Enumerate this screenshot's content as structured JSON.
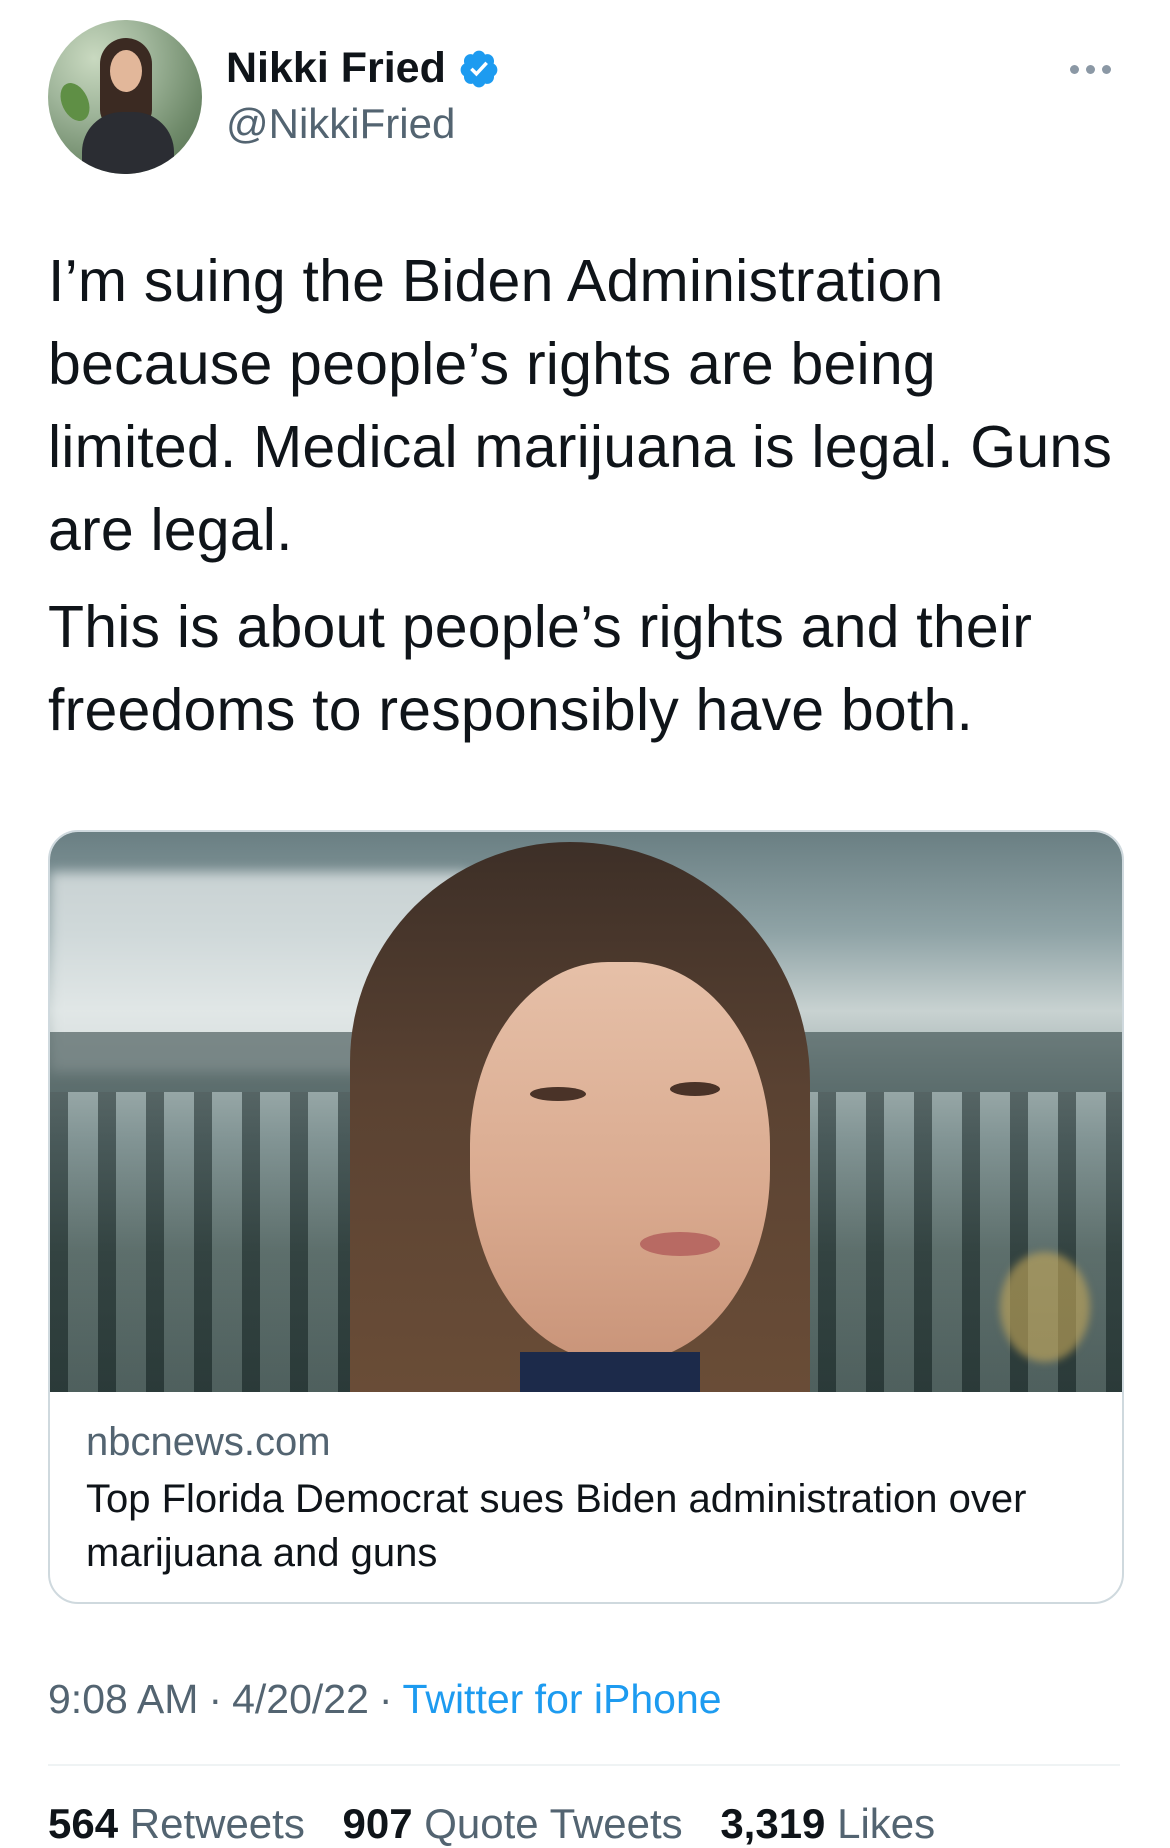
{
  "author": {
    "display_name": "Nikki Fried",
    "handle": "@NikkiFried",
    "verified": true
  },
  "tweet": {
    "paragraphs": [
      "I’m suing the Biden Administration because people’s rights are being limited. Medical marijuana is legal. Guns are legal.",
      "This is about people’s rights and their freedoms to responsibly have both."
    ]
  },
  "link_card": {
    "domain": "nbcnews.com",
    "title": "Top Florida Democrat sues Biden administration over marijuana and guns"
  },
  "meta": {
    "time": "9:08 AM",
    "date": "4/20/22",
    "separator": "·",
    "source": "Twitter for iPhone"
  },
  "stats": {
    "retweets_count": "564",
    "retweets_label": "Retweets",
    "quote_tweets_count": "907",
    "quote_tweets_label": "Quote Tweets",
    "likes_count": "3,319",
    "likes_label": "Likes"
  },
  "colors": {
    "accent": "#1d9bf0",
    "text_primary": "#0f1419",
    "text_secondary": "#536471",
    "border": "#cfd9de"
  },
  "icons": {
    "verified": "verified-badge-icon",
    "more": "more-horizontal-icon"
  }
}
